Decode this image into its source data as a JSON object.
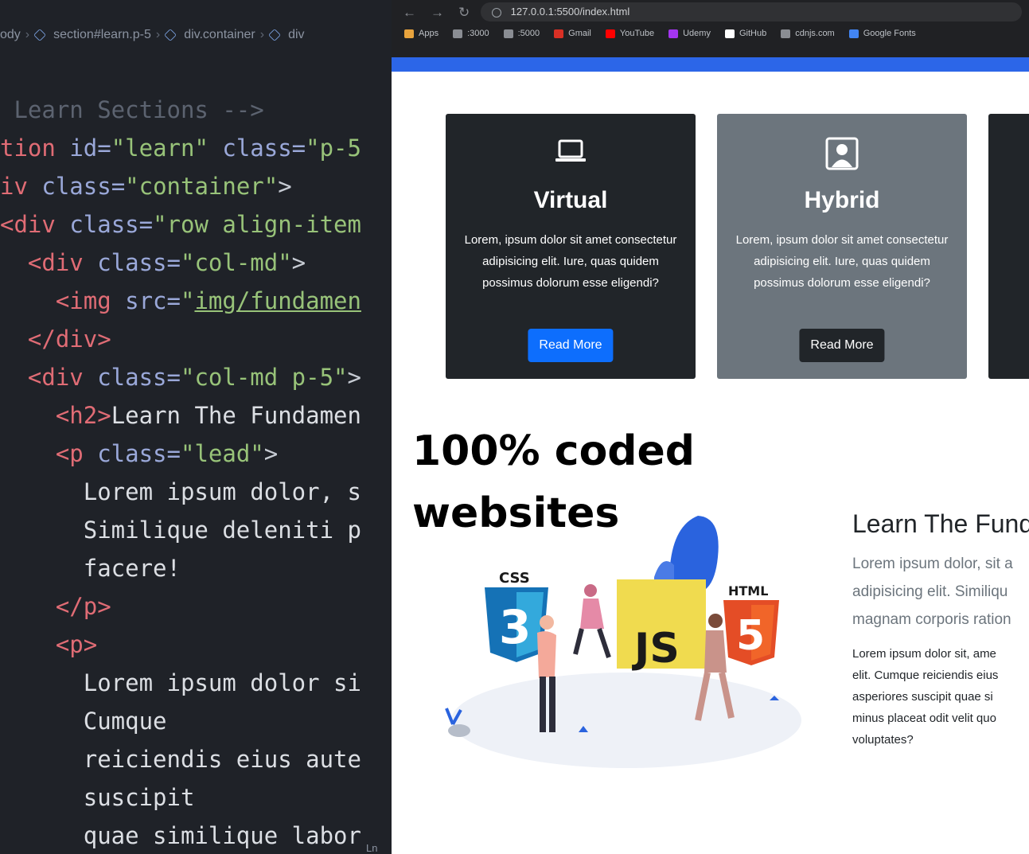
{
  "editor": {
    "breadcrumb": [
      "ody",
      "section#learn.p-5",
      "div.container",
      "div"
    ],
    "lines": [
      [
        {
          "t": " Learn Sections -->",
          "c": "c-comment"
        }
      ],
      [
        {
          "t": "tion ",
          "c": "c-tag"
        },
        {
          "t": "id=",
          "c": "c-attr"
        },
        {
          "t": "\"learn\"",
          "c": "c-str"
        },
        {
          "t": " class=",
          "c": "c-attr"
        },
        {
          "t": "\"p-5",
          "c": "c-str"
        }
      ],
      [
        {
          "t": "iv ",
          "c": "c-tag"
        },
        {
          "t": "class=",
          "c": "c-attr"
        },
        {
          "t": "\"container\"",
          "c": "c-str"
        },
        {
          "t": ">",
          "c": "c-pun"
        }
      ],
      [
        {
          "t": "<div ",
          "c": "c-tag"
        },
        {
          "t": "class=",
          "c": "c-attr"
        },
        {
          "t": "\"row align-item",
          "c": "c-str"
        }
      ],
      [
        {
          "t": "  <div ",
          "c": "c-tag"
        },
        {
          "t": "class=",
          "c": "c-attr"
        },
        {
          "t": "\"col-md\"",
          "c": "c-str"
        },
        {
          "t": ">",
          "c": "c-pun"
        }
      ],
      [
        {
          "t": "    <img ",
          "c": "c-tag"
        },
        {
          "t": "src=",
          "c": "c-attr"
        },
        {
          "t": "\"",
          "c": "c-str"
        },
        {
          "t": "img/fundamen",
          "c": "c-link"
        }
      ],
      [
        {
          "t": "  </div>",
          "c": "c-tag"
        }
      ],
      [
        {
          "t": "  <div ",
          "c": "c-tag"
        },
        {
          "t": "class=",
          "c": "c-attr"
        },
        {
          "t": "\"col-md p-5\"",
          "c": "c-str"
        },
        {
          "t": ">",
          "c": "c-pun"
        }
      ],
      [
        {
          "t": "    <h2>",
          "c": "c-tag"
        },
        {
          "t": "Learn The Fundamen",
          "c": "c-text"
        }
      ],
      [
        {
          "t": "    <p ",
          "c": "c-tag"
        },
        {
          "t": "class=",
          "c": "c-attr"
        },
        {
          "t": "\"lead\"",
          "c": "c-str"
        },
        {
          "t": ">",
          "c": "c-pun"
        }
      ],
      [
        {
          "t": "      Lorem ipsum dolor, s",
          "c": "c-text"
        }
      ],
      [
        {
          "t": "      Similique deleniti p",
          "c": "c-text"
        }
      ],
      [
        {
          "t": "      facere!",
          "c": "c-text"
        }
      ],
      [
        {
          "t": "    </p>",
          "c": "c-tag"
        }
      ],
      [
        {
          "t": "    <p>",
          "c": "c-tag"
        }
      ],
      [
        {
          "t": "      Lorem ipsum dolor si",
          "c": "c-text"
        }
      ],
      [
        {
          "t": "      Cumque",
          "c": "c-text"
        }
      ],
      [
        {
          "t": "      reiciendis eius aute",
          "c": "c-text"
        }
      ],
      [
        {
          "t": "      suscipit",
          "c": "c-text"
        }
      ],
      [
        {
          "t": "      quae similique labor",
          "c": "c-text"
        }
      ]
    ],
    "status": "Ln"
  },
  "browser": {
    "url": "127.0.0.1:5500/index.html",
    "bookmarks": [
      {
        "label": "Apps",
        "color": "#e8a33d"
      },
      {
        "label": ":3000",
        "color": "#8a8d93"
      },
      {
        "label": ":5000",
        "color": "#8a8d93"
      },
      {
        "label": "Gmail",
        "color": "#d93025"
      },
      {
        "label": "YouTube",
        "color": "#ff0000"
      },
      {
        "label": "Udemy",
        "color": "#a435f0"
      },
      {
        "label": "GitHub",
        "color": "#ffffff"
      },
      {
        "label": "cdnjs.com",
        "color": "#8a8d93"
      },
      {
        "label": "Google Fonts",
        "color": "#4285f4"
      }
    ]
  },
  "cards": [
    {
      "title": "Virtual",
      "text": "Lorem, ipsum dolor sit amet consectetur adipisicing elit. Iure, quas quidem possimus dolorum esse eligendi?",
      "button": "Read More"
    },
    {
      "title": "Hybrid",
      "text": "Lorem, ipsum dolor sit amet consectetur adipisicing elit. Iure, quas quidem possimus dolorum esse eligendi?",
      "button": "Read More"
    }
  ],
  "overlay": {
    "line1": "100% coded",
    "line2": "websites"
  },
  "illustration": {
    "css": "CSS",
    "html": "HTML",
    "js": "JS"
  },
  "learn": {
    "title": "Learn The Fund",
    "lead": [
      "Lorem ipsum dolor, sit a",
      "adipisicing elit. Similiqu",
      "magnam corporis ration"
    ],
    "body": [
      "Lorem ipsum dolor sit, ame",
      "elit. Cumque reiciendis eius",
      "asperiores suscipit quae si",
      "minus placeat odit velit quo",
      "voluptates?"
    ]
  }
}
